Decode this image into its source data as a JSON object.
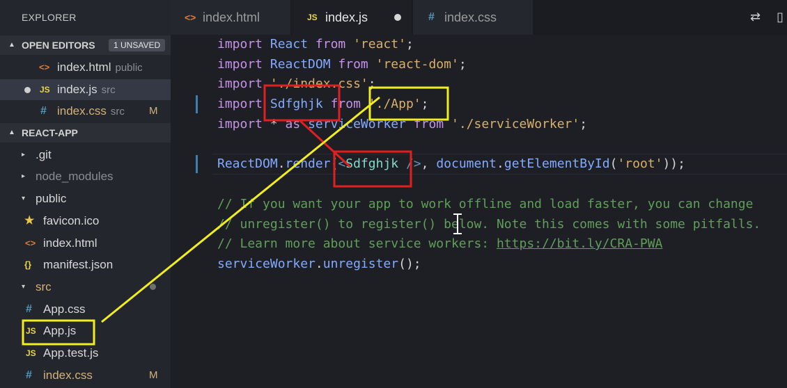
{
  "sidebar": {
    "title": "EXPLORER",
    "open_editors": {
      "label": "OPEN EDITORS",
      "badge": "1 UNSAVED",
      "items": [
        {
          "icon": "<>",
          "name": "index.html",
          "sub": "public"
        },
        {
          "icon": "JS",
          "name": "index.js",
          "sub": "src"
        },
        {
          "icon": "#",
          "name": "index.css",
          "sub": "src",
          "status": "M"
        }
      ]
    },
    "project": {
      "label": "REACT-APP",
      "items": [
        {
          "icon": "▸",
          "name": ".git"
        },
        {
          "icon": "▸",
          "name": "node_modules"
        },
        {
          "icon": "▾",
          "name": "public"
        },
        {
          "icon": "★",
          "name": "favicon.ico"
        },
        {
          "icon": "<>",
          "name": "index.html"
        },
        {
          "icon": "{}",
          "name": "manifest.json"
        },
        {
          "icon": "▾",
          "name": "src"
        },
        {
          "icon": "#",
          "name": "App.css"
        },
        {
          "icon": "JS",
          "name": "App.js"
        },
        {
          "icon": "JS",
          "name": "App.test.js"
        },
        {
          "icon": "#",
          "name": "index.css",
          "status": "M"
        }
      ]
    }
  },
  "tabs": [
    {
      "icon": "<>",
      "name": "index.html"
    },
    {
      "icon": "JS",
      "name": "index.js"
    },
    {
      "icon": "#",
      "name": "index.css"
    }
  ],
  "code": {
    "l1": {
      "a": "import",
      "b": " React ",
      "c": "from",
      "d": " 'react'",
      "e": ";"
    },
    "l2": {
      "a": "import",
      "b": " ReactDOM ",
      "c": "from",
      "d": " 'react-dom'",
      "e": ";"
    },
    "l3": {
      "a": "import",
      "d": " './index.css'",
      "e": ";"
    },
    "l4": {
      "a": "import",
      "b": " Sdfghjk ",
      "c": "from",
      "d": " './App'",
      "e": ";"
    },
    "l5": {
      "a": "import",
      "s": " * ",
      "as": "as",
      "b": " serviceWorker ",
      "c": "from",
      "d": " './serviceWorker'",
      "e": ";"
    },
    "l6": {
      "obj": "ReactDOM",
      "dot": ".",
      "fn": "render",
      "p1": "(",
      "lt": "<",
      "comp": "Sdfghjk",
      "close": " />",
      "p2": ", ",
      "doc": "document",
      "dot2": ".",
      "fn2": "getElementById",
      "p3": "(",
      "str": "'root'",
      "p4": "));"
    },
    "c1": "// If you want your app to work offline and load faster, you can change",
    "c2": "// unregister() to register() below. Note this comes with some pitfalls.",
    "c3a": "// Learn more about service workers: ",
    "c3b": "https://bit.ly/CRA-PWA",
    "l7": {
      "obj": "serviceWorker",
      "dot": ".",
      "fn": "unregister",
      "rest": "();"
    }
  },
  "colors": {
    "annotation_red": "#e02020",
    "annotation_yellow": "#f2ee1e"
  }
}
